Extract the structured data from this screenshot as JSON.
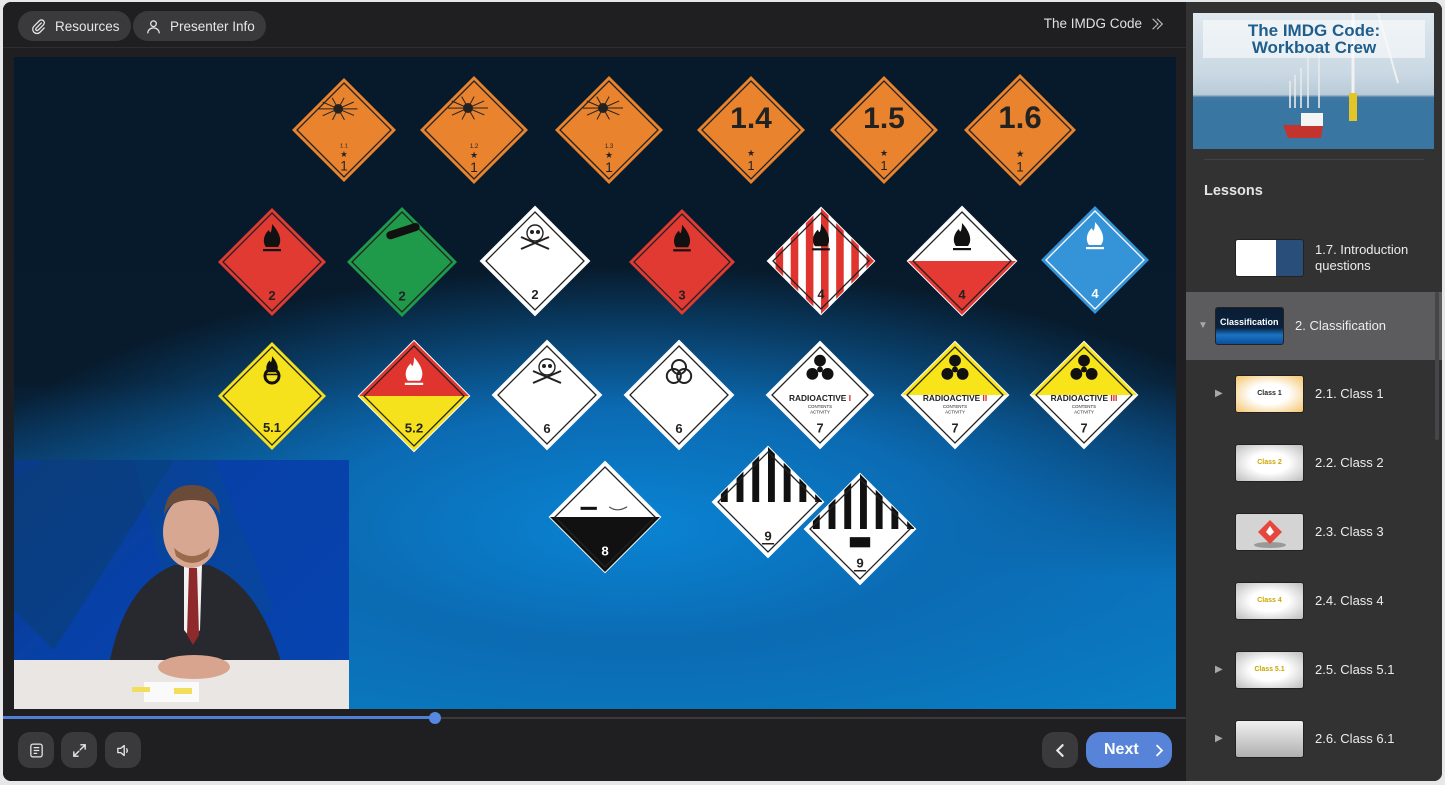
{
  "toolbar": {
    "resources_label": "Resources",
    "presenter_label": "Presenter Info",
    "breadcrumb": "The IMDG Code"
  },
  "course": {
    "thumbnail_title_line1": "The IMDG Code:",
    "thumbnail_title_line2": "Workboat Crew"
  },
  "sidebar": {
    "heading": "Lessons",
    "items": [
      {
        "label": "1.7. Introduction questions",
        "thumb_text": "",
        "expandable": false,
        "expanded": false,
        "active": false
      },
      {
        "label": "2. Classification",
        "thumb_text": "Classification",
        "expandable": true,
        "expanded": true,
        "active": true
      },
      {
        "label": "2.1. Class 1",
        "thumb_text": "Class 1",
        "expandable": true,
        "expanded": false,
        "active": false
      },
      {
        "label": "2.2. Class 2",
        "thumb_text": "Class 2",
        "expandable": false,
        "expanded": false,
        "active": false
      },
      {
        "label": "2.3. Class 3",
        "thumb_text": "",
        "expandable": false,
        "expanded": false,
        "active": false
      },
      {
        "label": "2.4. Class 4",
        "thumb_text": "Class 4",
        "expandable": false,
        "expanded": false,
        "active": false
      },
      {
        "label": "2.5. Class 5.1",
        "thumb_text": "Class 5.1",
        "expandable": true,
        "expanded": false,
        "active": false
      },
      {
        "label": "2.6. Class 6.1",
        "thumb_text": "",
        "expandable": true,
        "expanded": false,
        "active": false
      }
    ]
  },
  "slide": {
    "placards": [
      {
        "id": "1.1",
        "bg": "#e9832e",
        "symbol": "explosion",
        "top_text": "",
        "sub": "1.1",
        "num": "1"
      },
      {
        "id": "1.2",
        "bg": "#e9832e",
        "symbol": "explosion",
        "top_text": "",
        "sub": "1.2",
        "num": "1"
      },
      {
        "id": "1.3",
        "bg": "#e9832e",
        "symbol": "explosion",
        "top_text": "",
        "sub": "1.3",
        "num": "1"
      },
      {
        "id": "1.4",
        "bg": "#e9832e",
        "symbol": "text",
        "top_text": "1.4",
        "sub": "",
        "num": "1"
      },
      {
        "id": "1.5",
        "bg": "#e9832e",
        "symbol": "text",
        "top_text": "1.5",
        "sub": "",
        "num": "1"
      },
      {
        "id": "1.6",
        "bg": "#e9832e",
        "symbol": "text",
        "top_text": "1.6",
        "sub": "",
        "num": "1"
      },
      {
        "id": "2.1",
        "bg": "#e03a33",
        "symbol": "flame",
        "num": "2"
      },
      {
        "id": "2.2",
        "bg": "#1f9a4a",
        "symbol": "cylinder",
        "num": "2"
      },
      {
        "id": "2.3",
        "bg": "#ffffff",
        "symbol": "skull",
        "num": "2"
      },
      {
        "id": "3",
        "bg": "#e03a33",
        "symbol": "flame",
        "num": "3"
      },
      {
        "id": "4.1",
        "bg": "stripes",
        "symbol": "flame",
        "num": "4"
      },
      {
        "id": "4.2",
        "bg": "white-red",
        "symbol": "flame",
        "num": "4"
      },
      {
        "id": "4.3",
        "bg": "#3593d8",
        "symbol": "flame-white",
        "num": "4"
      },
      {
        "id": "5.1",
        "bg": "#f5e21c",
        "symbol": "oxidizer",
        "num": "5.1"
      },
      {
        "id": "5.2",
        "bg": "red-yellow",
        "symbol": "flame-white",
        "num": "5.2"
      },
      {
        "id": "6.1",
        "bg": "#ffffff",
        "symbol": "skull",
        "num": "6"
      },
      {
        "id": "6.2",
        "bg": "#ffffff",
        "symbol": "biohazard",
        "num": "6"
      },
      {
        "id": "7I",
        "bg": "#ffffff",
        "symbol": "radioactive",
        "label": "RADIOACTIVE",
        "roman": "I",
        "num": "7"
      },
      {
        "id": "7II",
        "bg": "yellow-white",
        "symbol": "radioactive",
        "label": "RADIOACTIVE",
        "roman": "II",
        "num": "7"
      },
      {
        "id": "7III",
        "bg": "yellow-white",
        "symbol": "radioactive",
        "label": "RADIOACTIVE",
        "roman": "III",
        "num": "7"
      },
      {
        "id": "8",
        "bg": "white-black",
        "symbol": "corrosive",
        "num": "8"
      },
      {
        "id": "9",
        "bg": "stripes-black",
        "symbol": "",
        "num": "9"
      },
      {
        "id": "9A",
        "bg": "stripes-black",
        "symbol": "battery",
        "num": "9"
      }
    ],
    "radioactive_sub1": "CONTENTS",
    "radioactive_sub2": "ACTIVITY"
  },
  "player": {
    "progress_fraction": 0.365,
    "next_label": "Next",
    "accent": "#5784d9"
  }
}
